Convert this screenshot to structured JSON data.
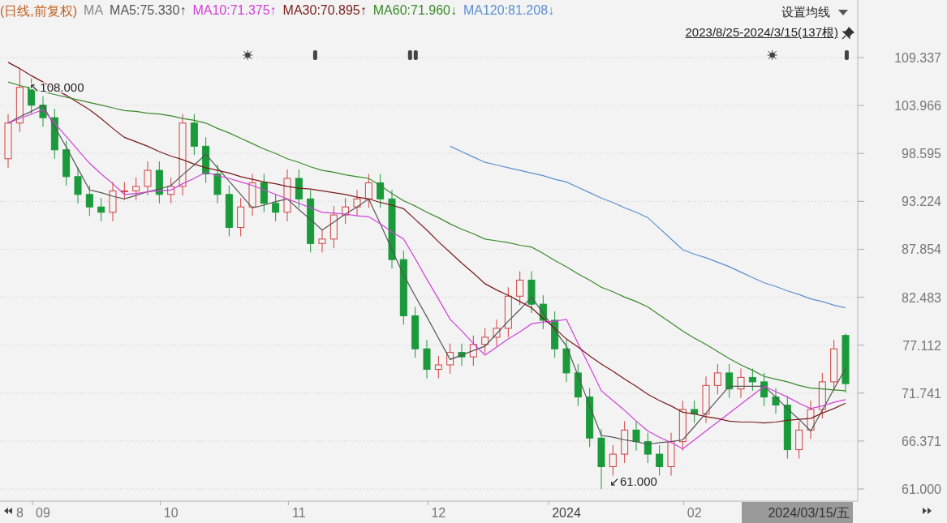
{
  "legend": {
    "mode": "(日线,前复权)",
    "ma_label": "MA",
    "readings": [
      ":75.330↑",
      ":71.375↑",
      ":70.895↑",
      ":71.960↓",
      ":81.208↓"
    ]
  },
  "settings": {
    "label": "设置均线",
    "range": "2023/8/25-2024/3/15(137根)"
  },
  "chart_data": {
    "type": "candlestick",
    "grid": true,
    "ylim": [
      61,
      109.337
    ],
    "categories": [
      null,
      "8",
      null,
      "09",
      null,
      null,
      null,
      null,
      null,
      null,
      null,
      null,
      null,
      null,
      "10",
      null,
      null,
      null,
      null,
      null,
      null,
      null,
      null,
      null,
      null,
      "11",
      null,
      null,
      null,
      null,
      null,
      null,
      null,
      null,
      null,
      null,
      null,
      "12",
      null,
      null,
      null,
      null,
      null,
      null,
      null,
      null,
      null,
      null,
      "2024",
      null,
      null,
      null,
      null,
      null,
      null,
      null,
      null,
      null,
      null,
      "02",
      null,
      null,
      null,
      null,
      null,
      null,
      null,
      null,
      null,
      null,
      null,
      null,
      null
    ],
    "yticks": [
      {
        "value": 61,
        "label": "61.000"
      },
      {
        "value": 66.371,
        "label": "66.371"
      },
      {
        "value": 71.741,
        "label": "71.741"
      },
      {
        "value": 77.112,
        "label": "77.112"
      },
      {
        "value": 82.483,
        "label": "82.483"
      },
      {
        "value": 87.854,
        "label": "87.854"
      },
      {
        "value": 93.224,
        "label": "93.224"
      },
      {
        "value": 98.595,
        "label": "98.595"
      },
      {
        "value": 103.966,
        "label": "103.966"
      },
      {
        "value": 109.337,
        "label": "109.337"
      }
    ],
    "ohlc": [
      [
        98,
        103,
        97,
        102
      ],
      [
        102,
        108,
        101,
        106
      ],
      [
        106,
        107,
        103,
        104
      ],
      [
        104,
        105,
        101.6,
        102.6
      ],
      [
        102.6,
        103.6,
        98,
        99
      ],
      [
        99,
        100,
        95,
        96
      ],
      [
        96,
        97,
        93,
        94
      ],
      [
        94,
        95,
        91.6,
        92.6
      ],
      [
        92.6,
        93.6,
        91,
        92
      ],
      [
        92,
        95.4,
        91,
        94.4
      ],
      [
        94.4,
        95.4,
        93.4,
        94.4
      ],
      [
        94.4,
        95.9,
        93.4,
        94.9
      ],
      [
        94.9,
        97.7,
        93.9,
        96.7
      ],
      [
        96.7,
        97.7,
        93,
        94
      ],
      [
        94,
        95.9,
        93,
        94.9
      ],
      [
        94.9,
        103,
        93.9,
        102
      ],
      [
        102,
        103,
        98.4,
        99.4
      ],
      [
        99.4,
        100.4,
        95.3,
        96.3
      ],
      [
        96.3,
        97.3,
        93,
        94
      ],
      [
        94,
        95,
        89.3,
        90.3
      ],
      [
        90.3,
        93.6,
        89.3,
        92.6
      ],
      [
        92.6,
        96.3,
        91.6,
        95.3
      ],
      [
        95.3,
        96.3,
        92,
        93
      ],
      [
        93,
        94,
        91,
        92
      ],
      [
        92,
        96.8,
        91,
        95.8
      ],
      [
        95.8,
        96.8,
        92.5,
        93.5
      ],
      [
        93.5,
        94.5,
        87.5,
        88.5
      ],
      [
        88.5,
        90,
        87.5,
        89
      ],
      [
        89,
        92.7,
        88,
        91.7
      ],
      [
        91.7,
        93.6,
        90.7,
        92.6
      ],
      [
        92.6,
        94.5,
        91.6,
        93.5
      ],
      [
        93.5,
        96.3,
        92.5,
        95.3
      ],
      [
        95.3,
        96.3,
        92.5,
        93.5
      ],
      [
        93.5,
        94.5,
        85.7,
        86.7
      ],
      [
        86.7,
        87.7,
        79.4,
        80.4
      ],
      [
        80.4,
        81.4,
        75.7,
        76.7
      ],
      [
        76.7,
        77.7,
        73.4,
        74.4
      ],
      [
        74.4,
        75.9,
        73.4,
        74.9
      ],
      [
        74.9,
        77.3,
        73.9,
        76.3
      ],
      [
        76.3,
        77.3,
        74.8,
        75.8
      ],
      [
        75.8,
        78.2,
        74.8,
        77.2
      ],
      [
        77.2,
        79,
        76.2,
        78
      ],
      [
        78,
        80,
        77,
        79
      ],
      [
        79,
        83.6,
        78,
        82.6
      ],
      [
        82.6,
        85.4,
        81.6,
        84.4
      ],
      [
        84.4,
        85.4,
        80.7,
        81.7
      ],
      [
        81.7,
        82.7,
        78.9,
        79.9
      ],
      [
        79.9,
        80.9,
        75.7,
        76.7
      ],
      [
        76.7,
        77.7,
        73,
        74
      ],
      [
        74,
        75,
        70.3,
        71.3
      ],
      [
        71.3,
        72.3,
        65.7,
        66.7
      ],
      [
        66.7,
        67.7,
        61,
        63.5
      ],
      [
        63.5,
        65.9,
        62.5,
        64.9
      ],
      [
        64.9,
        68.6,
        63.9,
        67.6
      ],
      [
        67.6,
        68.6,
        65.3,
        66.3
      ],
      [
        66.3,
        67.3,
        63.9,
        64.9
      ],
      [
        64.9,
        65.9,
        62.5,
        63.5
      ],
      [
        63.5,
        67.3,
        62.5,
        66.3
      ],
      [
        66.3,
        70.9,
        65.3,
        69.9
      ],
      [
        69.9,
        70.9,
        68.4,
        69.4
      ],
      [
        69.4,
        73.6,
        68.4,
        72.6
      ],
      [
        72.6,
        75,
        71.6,
        74
      ],
      [
        74,
        75,
        71.2,
        72.2
      ],
      [
        72.2,
        74.5,
        71.2,
        73.5
      ],
      [
        73.5,
        74.5,
        72,
        73
      ],
      [
        73,
        74,
        70.3,
        71.3
      ],
      [
        71.3,
        72.3,
        69.4,
        70.4
      ],
      [
        70.4,
        71.4,
        64.4,
        65.4
      ],
      [
        65.4,
        68.6,
        64.4,
        67.6
      ],
      [
        67.6,
        70.9,
        66.6,
        69.9
      ],
      [
        69.9,
        74,
        68.9,
        73
      ],
      [
        73,
        77.7,
        72,
        76.7
      ],
      [
        78.2,
        78.4,
        71.8,
        72.8
      ]
    ],
    "series": [
      {
        "name": "MA5",
        "type": "line",
        "color": "#555555",
        "values": [
          102,
          102.7,
          103.3,
          104,
          101.6,
          99.3,
          96.9,
          94.5,
          94.2,
          93.8,
          93.5,
          93.9,
          94.3,
          94.6,
          95,
          96.2,
          97.3,
          98.5,
          97,
          95.5,
          94,
          92.5,
          92.8,
          93.2,
          93.5,
          92.3,
          91.2,
          90,
          90.9,
          91.8,
          92.6,
          93.5,
          90.7,
          87.8,
          85,
          82.6,
          80.3,
          77.9,
          75.5,
          76,
          76.5,
          77,
          78.4,
          79.8,
          81.1,
          82.5,
          80.7,
          78.8,
          77,
          73.7,
          70.3,
          67,
          66.8,
          66.5,
          66.3,
          66,
          66.2,
          66.3,
          66.5,
          68,
          69.5,
          71,
          72.5,
          72.5,
          72.5,
          72.5,
          71.3,
          70,
          68.8,
          67.5,
          69.8,
          72.2,
          74.5
        ]
      },
      {
        "name": "MA10",
        "type": "line",
        "color": "#d040d8",
        "values": [
          102,
          102.5,
          103,
          103.5,
          102,
          100.5,
          99,
          97.5,
          96.3,
          95.2,
          94,
          94.1,
          94.3,
          94.4,
          94.5,
          95.2,
          95.8,
          96.5,
          96.1,
          95.8,
          95.4,
          95,
          94.5,
          94,
          93.5,
          93,
          92.5,
          92,
          91.9,
          91.8,
          91.6,
          91.5,
          90.7,
          89.8,
          89,
          86.8,
          84.5,
          82.3,
          80,
          78.7,
          77.3,
          76,
          76.9,
          77.8,
          78.6,
          79.5,
          79.7,
          79.8,
          80,
          77.3,
          74.7,
          72,
          70.9,
          69.8,
          68.6,
          67.5,
          66.8,
          66.2,
          65.5,
          66.5,
          67.5,
          68.5,
          69.5,
          70.5,
          71.5,
          72.5,
          71.9,
          71.3,
          70.6,
          70,
          70.3,
          70.7,
          71
        ]
      },
      {
        "name": "MA30",
        "type": "line",
        "color": "#7a1a1a",
        "values": [
          108.8,
          108.1,
          107.3,
          106.6,
          105.8,
          105.1,
          104.3,
          103.5,
          102.5,
          101.4,
          100.4,
          99.9,
          99.4,
          98.8,
          98.3,
          97.9,
          97.4,
          97,
          96.7,
          96.4,
          96,
          95.7,
          95.4,
          95.2,
          94.9,
          94.7,
          94.6,
          94.4,
          94.2,
          94,
          93.7,
          93.5,
          93.1,
          92.8,
          92.4,
          91.2,
          90,
          88.7,
          87.5,
          86.3,
          85.2,
          84,
          83.3,
          82.7,
          82,
          81.3,
          80.1,
          79,
          77.8,
          76.9,
          75.9,
          75,
          74.2,
          73.3,
          72.5,
          71.6,
          70.9,
          70.3,
          69.6,
          69.4,
          69.1,
          68.9,
          68.6,
          68.5,
          68.5,
          68.4,
          68.5,
          68.7,
          68.8,
          68.9,
          69.5,
          70,
          70.6
        ]
      },
      {
        "name": "MA60",
        "type": "line",
        "color": "#3a8a2a",
        "values": [
          106.6,
          106.2,
          105.9,
          105.5,
          105.2,
          104.9,
          104.6,
          104.3,
          104,
          103.7,
          103.4,
          103.3,
          103.1,
          103,
          102.8,
          102.5,
          102.3,
          102,
          101.4,
          100.9,
          100.3,
          99.7,
          99.1,
          98.6,
          98,
          97.6,
          97.1,
          96.7,
          96.5,
          96.2,
          96,
          95.8,
          95,
          94.1,
          93.3,
          92.7,
          92,
          91.4,
          90.7,
          90.1,
          89.6,
          89,
          88.8,
          88.6,
          88.3,
          88.1,
          87.4,
          86.6,
          85.9,
          85.1,
          84.4,
          83.6,
          83.1,
          82.5,
          82,
          81.4,
          80.5,
          79.6,
          78.7,
          77.9,
          77.2,
          76.4,
          75.6,
          74.9,
          74.3,
          73.6,
          73.3,
          73,
          72.6,
          72.3,
          72.2,
          72.1,
          72
        ]
      },
      {
        "name": "MA120",
        "type": "line",
        "color": "#5b8fd0",
        "values": [
          null,
          null,
          null,
          null,
          null,
          null,
          null,
          null,
          null,
          null,
          null,
          null,
          null,
          null,
          null,
          null,
          null,
          null,
          null,
          null,
          null,
          null,
          null,
          null,
          null,
          null,
          null,
          null,
          null,
          null,
          null,
          null,
          null,
          null,
          null,
          null,
          null,
          null,
          99.4,
          98.8,
          98.2,
          97.6,
          97.3,
          97,
          96.7,
          96.4,
          96.1,
          95.7,
          95.4,
          94.8,
          94.2,
          93.6,
          93.1,
          92.5,
          92,
          91.4,
          90.2,
          89,
          87.8,
          87.3,
          86.9,
          86.4,
          85.9,
          85.3,
          84.7,
          84.1,
          83.7,
          83.2,
          82.8,
          82.3,
          82,
          81.6,
          81.3
        ]
      }
    ],
    "annotations": [
      "↖108.000",
      "↙61.000"
    ]
  },
  "event_markers": [
    {
      "kind": "sun"
    },
    {
      "kind": "bar"
    },
    {
      "kind": "double_bar"
    },
    {
      "kind": "sun"
    },
    {
      "kind": "bar"
    }
  ],
  "cursor_label": {
    "text": "2024/03/15/五"
  }
}
